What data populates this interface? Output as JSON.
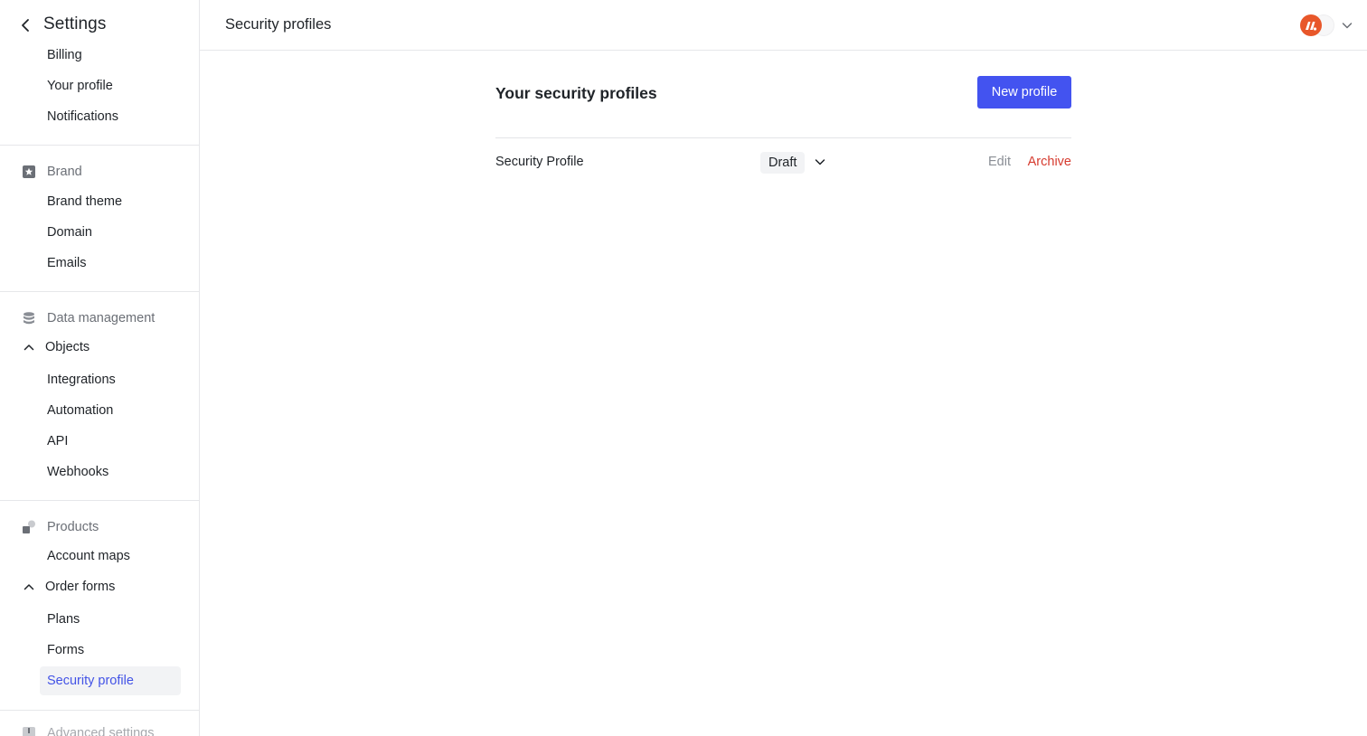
{
  "sidebar": {
    "title": "Settings",
    "account_items": [
      "Billing",
      "Your profile",
      "Notifications"
    ],
    "brand": {
      "label": "Brand",
      "items": [
        "Brand theme",
        "Domain",
        "Emails"
      ]
    },
    "data_management": {
      "label": "Data management",
      "objects_label": "Objects",
      "items": [
        "Integrations",
        "Automation",
        "API",
        "Webhooks"
      ]
    },
    "products": {
      "label": "Products",
      "account_maps": "Account maps",
      "order_forms_label": "Order forms",
      "items": [
        "Plans",
        "Forms",
        "Security profile"
      ]
    },
    "advanced": {
      "label": "Advanced settings"
    }
  },
  "topbar": {
    "title": "Security profiles",
    "avatar_icon": "brand-logo-icon"
  },
  "main": {
    "heading": "Your security profiles",
    "new_button": "New profile",
    "profiles": [
      {
        "name": "Security Profile",
        "status": "Draft",
        "edit_label": "Edit",
        "archive_label": "Archive"
      }
    ]
  },
  "colors": {
    "accent": "#4353f0",
    "active_text": "#4353e6",
    "danger": "#d63b2f",
    "avatar": "#e8572a"
  }
}
